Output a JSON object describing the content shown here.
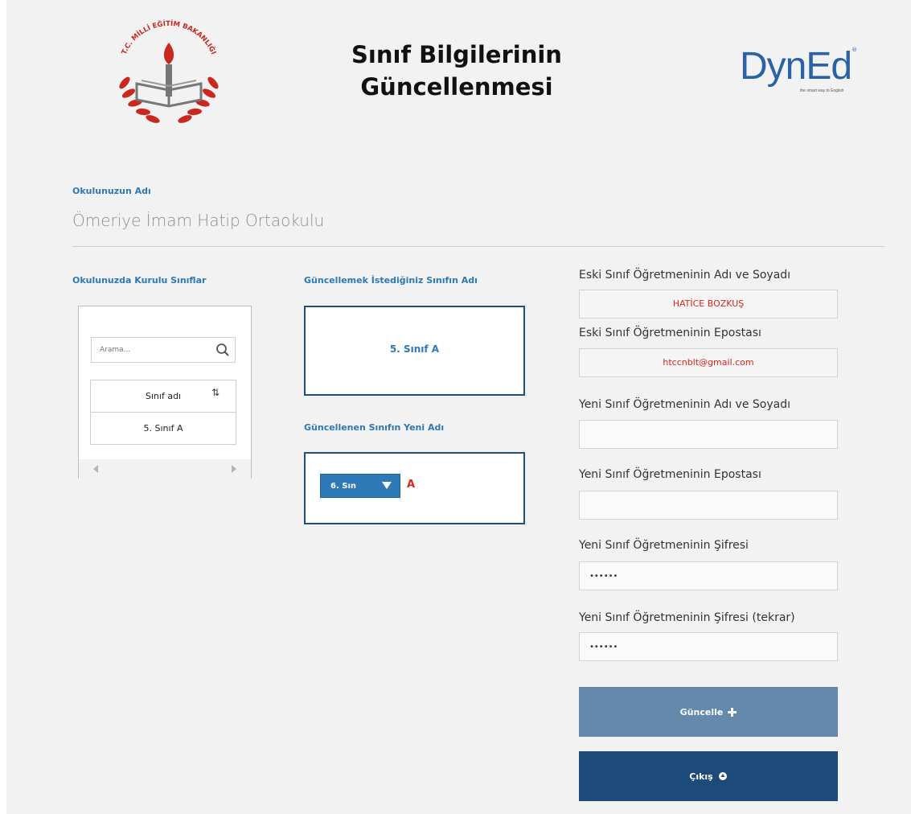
{
  "header": {
    "title_line1": "Sınıf Bilgilerinin",
    "title_line2": "Güncellenmesi",
    "meb_logo_text": "T.C. MİLLİ EĞİTİM BAKANLIĞI",
    "dyned_logo_text": "DynEd",
    "dyned_tagline": "the smart way to English"
  },
  "school": {
    "label": "Okulunuzun Adı",
    "name": "Ömeriye İmam Hatip Ortaokulu"
  },
  "class_list": {
    "label": "Okulunuzda Kurulu Sınıflar",
    "search_placeholder": "Arama...",
    "column_header": "Sınıf adı",
    "rows": [
      "5. Sınıf A"
    ]
  },
  "current_class": {
    "label": "Güncellemek İstediğiniz Sınıfın Adı",
    "value": "5. Sınıf A"
  },
  "new_class": {
    "label": "Güncellenen Sınıfın Yeni Adı",
    "grade_selected": "6. Sın",
    "section": "A"
  },
  "form": {
    "old_teacher_name_label": "Eski Sınıf Öğretmeninin Adı ve Soyadı",
    "old_teacher_name_value": "HATİCE BOZKUŞ",
    "old_teacher_email_label": "Eski Sınıf Öğretmeninin Epostası",
    "old_teacher_email_value": "htccnblt@gmail.com",
    "new_teacher_name_label": "Yeni Sınıf Öğretmeninin Adı ve Soyadı",
    "new_teacher_name_value": "",
    "new_teacher_email_label": "Yeni Sınıf Öğretmeninin Epostası",
    "new_teacher_email_value": "",
    "new_password_label": "Yeni Sınıf Öğretmeninin Şifresi",
    "new_password_value": "••••••",
    "new_password_repeat_label": "Yeni Sınıf Öğretmeninin Şifresi (tekrar)",
    "new_password_repeat_value": "••••••"
  },
  "buttons": {
    "update_label": "Güncelle",
    "exit_label": "Çıkış"
  },
  "colors": {
    "accent_blue": "#2e78b5",
    "dark_navy": "#1c4b7a",
    "update_button": "#6489ad",
    "red_text": "#d9261c"
  }
}
